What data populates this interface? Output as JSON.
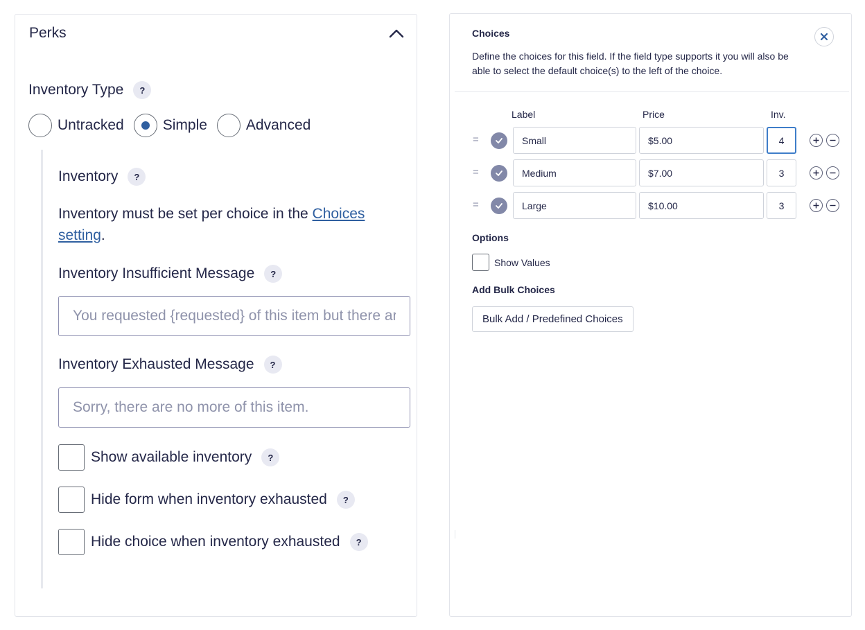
{
  "perks": {
    "title": "Perks",
    "inventory_type": {
      "label": "Inventory Type",
      "help": "?",
      "options": [
        {
          "label": "Untracked",
          "selected": false
        },
        {
          "label": "Simple",
          "selected": true
        },
        {
          "label": "Advanced",
          "selected": false
        }
      ]
    },
    "inventory": {
      "label": "Inventory",
      "help": "?",
      "info_prefix": "Inventory must be set per choice in the ",
      "info_link": "Choices setting",
      "info_suffix": "."
    },
    "insufficient": {
      "label": "Inventory Insufficient Message",
      "help": "?",
      "placeholder": "You requested {requested} of this item but there are only {available} left."
    },
    "exhausted": {
      "label": "Inventory Exhausted Message",
      "help": "?",
      "placeholder": "Sorry, there are no more of this item."
    },
    "checkboxes": [
      {
        "label": "Show available inventory",
        "help": "?",
        "checked": false
      },
      {
        "label": "Hide form when inventory exhausted",
        "help": "?",
        "checked": false
      },
      {
        "label": "Hide choice when inventory exhausted",
        "help": "?",
        "checked": false
      }
    ]
  },
  "choices": {
    "title": "Choices",
    "description": "Define the choices for this field. If the field type supports it you will also be able to select the default choice(s) to the left of the choice.",
    "columns": {
      "label": "Label",
      "price": "Price",
      "inv": "Inv."
    },
    "rows": [
      {
        "label": "Small",
        "price": "$5.00",
        "inv": "4",
        "default": true
      },
      {
        "label": "Medium",
        "price": "$7.00",
        "inv": "3",
        "default": true
      },
      {
        "label": "Large",
        "price": "$10.00",
        "inv": "3",
        "default": true
      }
    ],
    "options_label": "Options",
    "show_values_label": "Show Values",
    "bulk_label": "Add Bulk Choices",
    "bulk_button": "Bulk Add / Predefined Choices"
  },
  "colors": {
    "accent": "#2f5fa0",
    "text": "#242748",
    "border": "#e2e4ea"
  }
}
